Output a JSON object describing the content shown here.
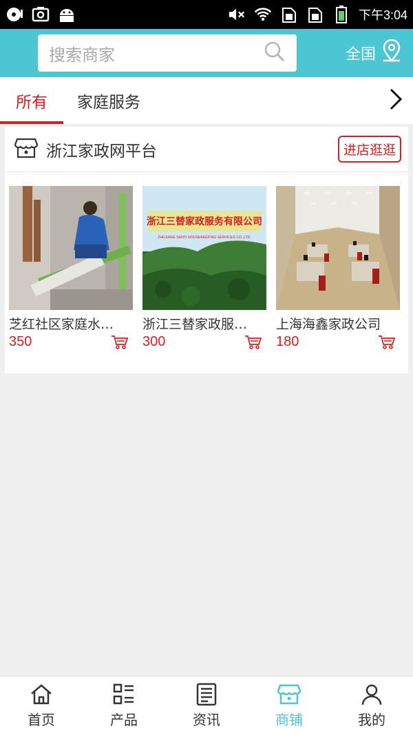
{
  "status_bar": {
    "time": "下午3:04",
    "left_icons": [
      "disc-icon",
      "screenshot-icon",
      "android-icon"
    ],
    "right_icons": [
      "mute-icon",
      "wifi-icon",
      "sim1-icon",
      "sim2-icon",
      "battery-icon"
    ]
  },
  "header": {
    "search_placeholder": "搜索商家",
    "region_label": "全国",
    "icons": [
      "search-icon",
      "location-icon"
    ]
  },
  "tabs": [
    {
      "label": "所有",
      "active": true
    },
    {
      "label": "家庭服务",
      "active": false
    }
  ],
  "store": {
    "name": "浙江家政网平台",
    "visit_label": "进店逛逛",
    "products": [
      {
        "name": "芝红社区家庭水…",
        "price": "350"
      },
      {
        "name": "浙江三替家政服…",
        "price": "300",
        "image_text": "浙江三替家政服务有限公司",
        "image_subtext": "ZHEJIANG SANTI HOUSEKEEPING SERVICES CO.,LTD."
      },
      {
        "name": "上海海鑫家政公司",
        "price": "180"
      }
    ]
  },
  "bottom_nav": [
    {
      "label": "首页",
      "icon": "home-icon",
      "active": false
    },
    {
      "label": "产品",
      "icon": "grid-list-icon",
      "active": false
    },
    {
      "label": "资讯",
      "icon": "news-icon",
      "active": false
    },
    {
      "label": "商铺",
      "icon": "store-icon",
      "active": true
    },
    {
      "label": "我的",
      "icon": "user-icon",
      "active": false
    }
  ],
  "colors": {
    "accent": "#4cc6d2",
    "highlight": "#d81e1e",
    "background": "#efefef"
  }
}
